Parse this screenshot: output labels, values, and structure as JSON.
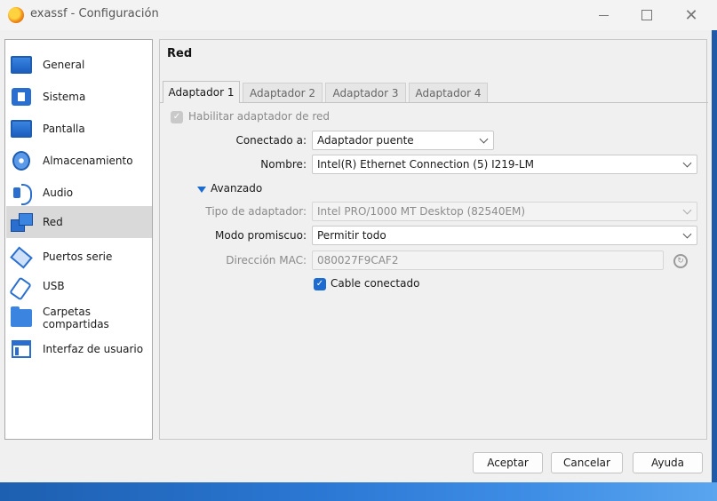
{
  "window": {
    "title": "exassf - Configuración",
    "controls": {
      "minimize": "—",
      "maximize": "",
      "close": "✕"
    }
  },
  "sidebar": {
    "items": [
      {
        "label": "General",
        "icon": "monitor-icon"
      },
      {
        "label": "Sistema",
        "icon": "chip-icon"
      },
      {
        "label": "Pantalla",
        "icon": "display-icon"
      },
      {
        "label": "Almacenamiento",
        "icon": "disk-icon"
      },
      {
        "label": "Audio",
        "icon": "audio-icon"
      },
      {
        "label": "Red",
        "icon": "network-icon",
        "selected": true
      },
      {
        "label": "Puertos serie",
        "icon": "serial-port-icon"
      },
      {
        "label": "USB",
        "icon": "usb-icon"
      },
      {
        "label": "Carpetas compartidas",
        "icon": "folder-icon"
      },
      {
        "label": "Interfaz de usuario",
        "icon": "user-interface-icon"
      }
    ]
  },
  "main": {
    "title": "Red",
    "tabs": [
      {
        "label": "Adaptador 1",
        "active": true
      },
      {
        "label": "Adaptador 2"
      },
      {
        "label": "Adaptador 3"
      },
      {
        "label": "Adaptador 4"
      }
    ],
    "enable_adapter": {
      "label": "Habilitar adaptador de red",
      "checked": true,
      "disabled": true
    },
    "connected_to": {
      "label": "Conectado a:",
      "value": "Adaptador puente"
    },
    "name": {
      "label": "Nombre:",
      "value": "Intel(R) Ethernet Connection (5) I219-LM"
    },
    "advanced": {
      "label": "Avanzado",
      "expanded": true
    },
    "adapter_type": {
      "label": "Tipo de adaptador:",
      "value": "Intel PRO/1000 MT Desktop (82540EM)",
      "disabled": true
    },
    "promiscuous_mode": {
      "label": "Modo promiscuo:",
      "value": "Permitir todo"
    },
    "mac_address": {
      "label": "Dirección MAC:",
      "value": "080027F9CAF2",
      "disabled": true
    },
    "cable_connected": {
      "label": "Cable conectado",
      "checked": true
    }
  },
  "buttons": {
    "accept": "Aceptar",
    "cancel": "Cancelar",
    "help": "Ayuda"
  },
  "colors": {
    "accent": "#1b6bd1",
    "selected_row": "#d9d9d9",
    "window_bg": "#f0f0f0"
  }
}
